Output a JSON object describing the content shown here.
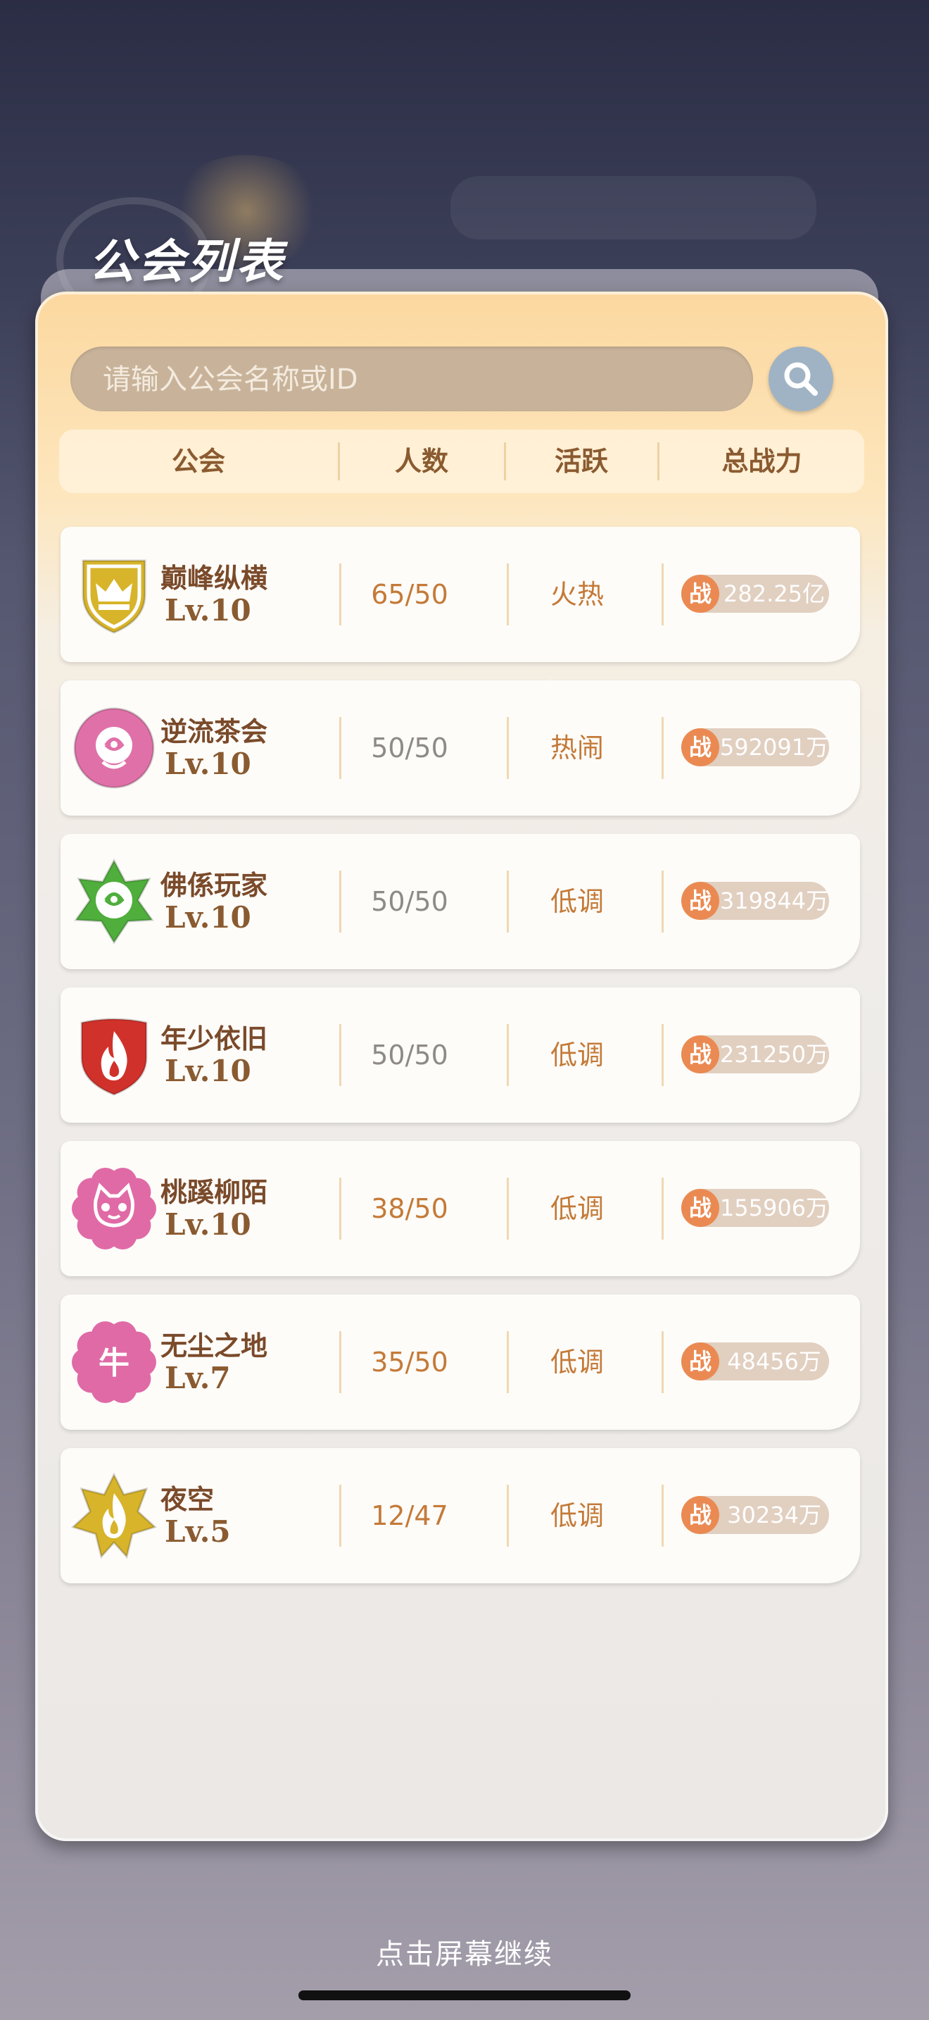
{
  "page_title": "公会列表",
  "search": {
    "placeholder": "请输入公会名称或ID"
  },
  "table_headers": {
    "guild": "公会",
    "members": "人数",
    "activity": "活跃",
    "power": "总战力"
  },
  "power_badge_label": "战",
  "colors": {
    "accent_orange": "#ea8a52",
    "members_full": "#8f8a85",
    "members_open": "#c47a38",
    "title_brown": "#7a4a2a"
  },
  "guilds": [
    {
      "name": "巅峰纵横",
      "level": "Lv.10",
      "members": "65/50",
      "activity": "火热",
      "power": "282.25亿",
      "emblem": "crown-shield",
      "emblem_color": "#d7b42a",
      "members_color": "#c47a38"
    },
    {
      "name": "逆流茶会",
      "level": "Lv.10",
      "members": "50/50",
      "activity": "热闹",
      "power": "592091万",
      "emblem": "rose-circle",
      "emblem_color": "#e071a8",
      "members_color": "#8f8a85"
    },
    {
      "name": "佛係玩家",
      "level": "Lv.10",
      "members": "50/50",
      "activity": "低调",
      "power": "319844万",
      "emblem": "rose-star",
      "emblem_color": "#4fae3c",
      "members_color": "#8f8a85"
    },
    {
      "name": "年少依旧",
      "level": "Lv.10",
      "members": "50/50",
      "activity": "低调",
      "power": "231250万",
      "emblem": "flame-shield",
      "emblem_color": "#d0322b",
      "members_color": "#8f8a85"
    },
    {
      "name": "桃蹊柳陌",
      "level": "Lv.10",
      "members": "38/50",
      "activity": "低调",
      "power": "155906万",
      "emblem": "cat-flower",
      "emblem_color": "#e06aa6",
      "members_color": "#c47a38"
    },
    {
      "name": "无尘之地",
      "level": "Lv.7",
      "members": "35/50",
      "activity": "低调",
      "power": "48456万",
      "emblem": "ox-flower",
      "emblem_color": "#e06aa6",
      "emblem_text": "牛",
      "members_color": "#c47a38"
    },
    {
      "name": "夜空",
      "level": "Lv.5",
      "members": "12/47",
      "activity": "低调",
      "power": "30234万",
      "emblem": "flame-star",
      "emblem_color": "#d7b42a",
      "members_color": "#c47a38"
    }
  ],
  "footer": {
    "continue_text": "点击屏幕继续"
  }
}
